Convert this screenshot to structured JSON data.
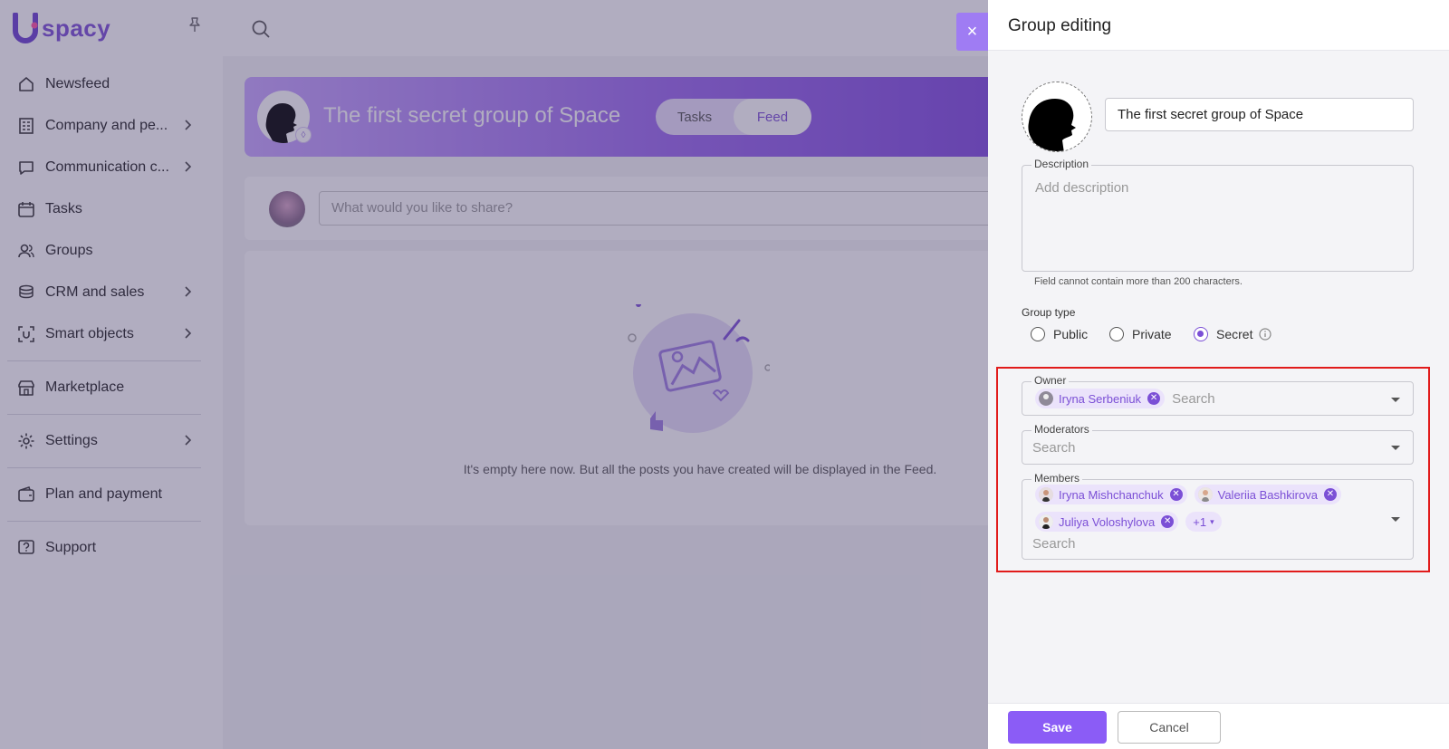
{
  "app": {
    "logo_text": "spacy"
  },
  "sidebar": {
    "items": [
      {
        "label": "Newsfeed",
        "icon": "home-icon",
        "chevron": false
      },
      {
        "label": "Company and pe...",
        "icon": "building-icon",
        "chevron": true
      },
      {
        "label": "Communication c...",
        "icon": "chat-icon",
        "chevron": true
      },
      {
        "label": "Tasks",
        "icon": "calendar-icon",
        "chevron": false
      },
      {
        "label": "Groups",
        "icon": "users-icon",
        "chevron": false
      },
      {
        "label": "CRM and sales",
        "icon": "stack-icon",
        "chevron": true
      },
      {
        "label": "Smart objects",
        "icon": "scan-icon",
        "chevron": true
      },
      {
        "label": "Marketplace",
        "icon": "store-icon",
        "chevron": false
      },
      {
        "label": "Settings",
        "icon": "gear-icon",
        "chevron": true
      },
      {
        "label": "Plan and payment",
        "icon": "wallet-icon",
        "chevron": false
      },
      {
        "label": "Support",
        "icon": "help-icon",
        "chevron": false
      }
    ]
  },
  "group_page": {
    "title": "The first secret group of Space",
    "tabs": [
      "Tasks",
      "Feed"
    ],
    "active_tab": "Feed",
    "share_placeholder": "What would you like to share?",
    "empty_text": "It's empty here now. But all the posts you have created will be displayed in the Feed."
  },
  "drawer": {
    "title": "Group editing",
    "close_symbol": "×",
    "name_value": "The first secret group of Space",
    "description": {
      "label": "Description",
      "placeholder": "Add description",
      "helper": "Field cannot contain more than 200 characters."
    },
    "group_type": {
      "label": "Group type",
      "options": [
        "Public",
        "Private",
        "Secret"
      ],
      "selected": "Secret"
    },
    "owner": {
      "label": "Owner",
      "chips": [
        "Iryna Serbeniuk"
      ],
      "search_placeholder": "Search"
    },
    "moderators": {
      "label": "Moderators",
      "search_placeholder": "Search"
    },
    "members": {
      "label": "Members",
      "chips": [
        "Iryna Mishchanchuk",
        "Valeriia Bashkirova",
        "Juliya Voloshylova"
      ],
      "more": "+1",
      "search_placeholder": "Search"
    },
    "save_label": "Save",
    "cancel_label": "Cancel"
  },
  "colors": {
    "accent": "#7b4fd6",
    "button": "#8b5cf6",
    "highlight": "#e11b1b"
  }
}
